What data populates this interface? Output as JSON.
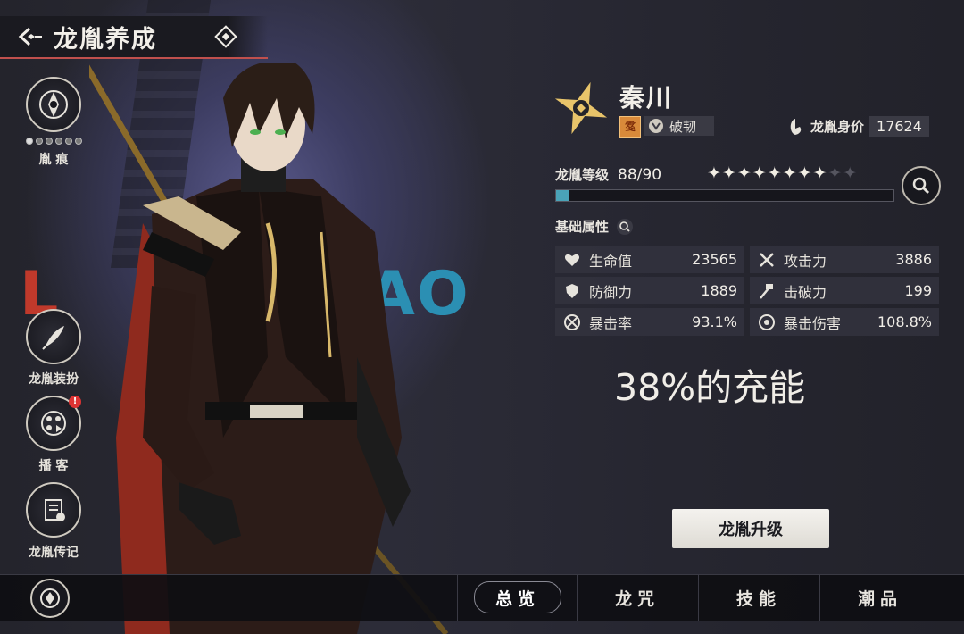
{
  "header": {
    "title": "龙胤养成"
  },
  "left_menu": [
    {
      "label": "胤 痕",
      "dots": 6,
      "dots_filled": 1
    },
    {
      "label": "龙胤装扮"
    },
    {
      "label": "播 客",
      "badge": "!"
    },
    {
      "label": "龙胤传记"
    }
  ],
  "background_text": {
    "left": "L",
    "right": "IAO"
  },
  "character": {
    "name": "秦川",
    "seal": "𩃔",
    "tag": "破韧",
    "price_label": "龙胤身价",
    "price_value": "17624"
  },
  "level": {
    "label": "龙胤等级",
    "value": "88/90",
    "progress": 0.04,
    "stars_total": 10,
    "stars_filled": 8
  },
  "basic": {
    "label": "基础属性"
  },
  "stats": [
    {
      "icon": "heart-icon",
      "name": "生命值",
      "value": "23565"
    },
    {
      "icon": "swords-icon",
      "name": "攻击力",
      "value": "3886"
    },
    {
      "icon": "shield-icon",
      "name": "防御力",
      "value": "1889"
    },
    {
      "icon": "hammer-icon",
      "name": "击破力",
      "value": "199"
    },
    {
      "icon": "crit-icon",
      "name": "暴击率",
      "value": "93.1%"
    },
    {
      "icon": "eye-target-icon",
      "name": "暴击伤害",
      "value": "108.8%"
    }
  ],
  "charge_text": "38%的充能",
  "upgrade_button": "龙胤升级",
  "tabs": [
    {
      "label": "总览",
      "active": true
    },
    {
      "label": "龙咒",
      "active": false
    },
    {
      "label": "技能",
      "active": false
    },
    {
      "label": "潮品",
      "active": false
    }
  ],
  "colors": {
    "accent_red": "#c0504d",
    "progress": "#4aa3b8",
    "gold": "#e8c46a"
  }
}
